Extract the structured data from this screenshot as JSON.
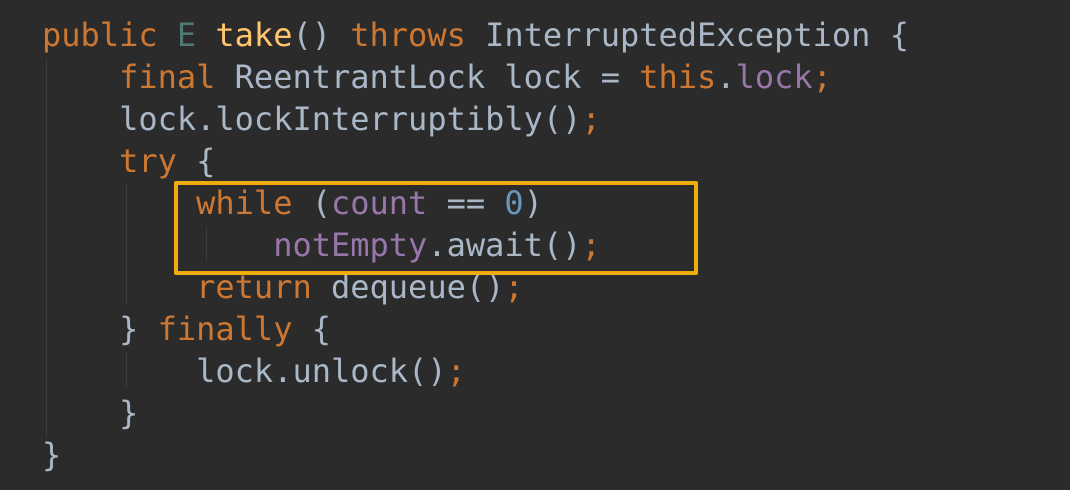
{
  "code": {
    "lines": [
      {
        "indent": "",
        "tokens": [
          {
            "t": "public",
            "c": "kw"
          },
          {
            "t": " ",
            "c": "pl"
          },
          {
            "t": "E",
            "c": "tp"
          },
          {
            "t": " ",
            "c": "pl"
          },
          {
            "t": "take",
            "c": "fn"
          },
          {
            "t": "() ",
            "c": "pl"
          },
          {
            "t": "throws",
            "c": "kw"
          },
          {
            "t": " InterruptedException {",
            "c": "pl"
          }
        ]
      },
      {
        "indent": "    ",
        "tokens": [
          {
            "t": "final",
            "c": "kw"
          },
          {
            "t": " ReentrantLock lock = ",
            "c": "pl"
          },
          {
            "t": "this",
            "c": "kw"
          },
          {
            "t": ".",
            "c": "pl"
          },
          {
            "t": "lock",
            "c": "fld"
          },
          {
            "t": ";",
            "c": "kw"
          }
        ]
      },
      {
        "indent": "    ",
        "tokens": [
          {
            "t": "lock.lockInterruptibly()",
            "c": "pl"
          },
          {
            "t": ";",
            "c": "kw"
          }
        ]
      },
      {
        "indent": "    ",
        "tokens": [
          {
            "t": "try",
            "c": "kw"
          },
          {
            "t": " {",
            "c": "pl"
          }
        ]
      },
      {
        "indent": "        ",
        "tokens": [
          {
            "t": "while",
            "c": "kw"
          },
          {
            "t": " (",
            "c": "pl"
          },
          {
            "t": "count",
            "c": "fld"
          },
          {
            "t": " == ",
            "c": "pl"
          },
          {
            "t": "0",
            "c": "num"
          },
          {
            "t": ")",
            "c": "pl"
          }
        ]
      },
      {
        "indent": "            ",
        "tokens": [
          {
            "t": "notEmpty",
            "c": "fld"
          },
          {
            "t": ".await()",
            "c": "pl"
          },
          {
            "t": ";",
            "c": "kw"
          }
        ]
      },
      {
        "indent": "        ",
        "tokens": [
          {
            "t": "return",
            "c": "kw"
          },
          {
            "t": " dequeue()",
            "c": "pl"
          },
          {
            "t": ";",
            "c": "kw"
          }
        ]
      },
      {
        "indent": "    ",
        "tokens": [
          {
            "t": "} ",
            "c": "pl"
          },
          {
            "t": "finally",
            "c": "kw"
          },
          {
            "t": " {",
            "c": "pl"
          }
        ]
      },
      {
        "indent": "        ",
        "tokens": [
          {
            "t": "lock.unlock()",
            "c": "pl"
          },
          {
            "t": ";",
            "c": "kw"
          }
        ]
      },
      {
        "indent": "    ",
        "tokens": [
          {
            "t": "}",
            "c": "pl"
          }
        ]
      },
      {
        "indent": "",
        "tokens": [
          {
            "t": "}",
            "c": "pl"
          }
        ]
      }
    ]
  },
  "colors": {
    "background": "#2b2b2b",
    "keyword": "#cc7832",
    "type_param": "#507874",
    "method": "#ffc66d",
    "field": "#9876aa",
    "number": "#6897bb",
    "plain": "#a9b7c6",
    "highlight_border": "#f0ae0c"
  }
}
